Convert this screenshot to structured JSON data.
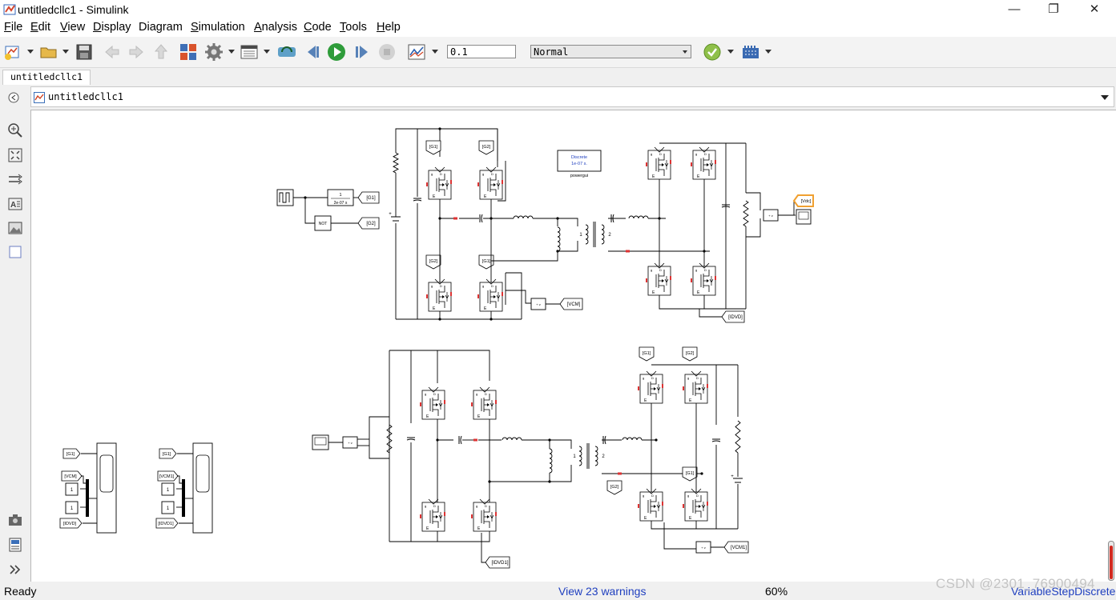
{
  "window": {
    "title": "untitledcllc1 - Simulink",
    "controls": {
      "minimize": "—",
      "restore": "❐",
      "close": "✕"
    }
  },
  "menu": [
    {
      "label": "File",
      "underline": "F",
      "rest": "ile"
    },
    {
      "label": "Edit",
      "underline": "E",
      "rest": "dit"
    },
    {
      "label": "View",
      "underline": "V",
      "rest": "iew"
    },
    {
      "label": "Display",
      "underline": "D",
      "rest": "isplay"
    },
    {
      "label": "Diagram",
      "underline": "",
      "rest": "Diagram"
    },
    {
      "label": "Simulation",
      "underline": "S",
      "rest": "imulation"
    },
    {
      "label": "Analysis",
      "underline": "A",
      "rest": "nalysis"
    },
    {
      "label": "Code",
      "underline": "C",
      "rest": "ode"
    },
    {
      "label": "Tools",
      "underline": "T",
      "rest": "ools"
    },
    {
      "label": "Help",
      "underline": "H",
      "rest": "elp"
    }
  ],
  "toolbar": {
    "stop_time": "0.1",
    "sim_mode": "Normal",
    "icons": [
      "new-model-icon",
      "open-icon",
      "save-icon",
      "back-icon",
      "forward-icon",
      "up-icon",
      "library-browser-icon",
      "model-config-icon",
      "model-explorer-icon",
      "update-diagram-icon",
      "step-back-icon",
      "run-icon",
      "step-forward-icon",
      "stop-icon",
      "data-inspector-icon",
      "model-advisor-icon",
      "build-icon"
    ]
  },
  "tab": {
    "label": "untitledcllc1"
  },
  "address": {
    "path": "untitledcllc1"
  },
  "palette_icons": [
    "zoom-icon",
    "fit-view-icon",
    "arrow-route-icon",
    "annotation-icon",
    "image-icon",
    "area-icon",
    "screenshot-icon",
    "model-browser-icon",
    "expand-icon"
  ],
  "diagram": {
    "powergui": {
      "line1": "Discrete",
      "line2": "1e-07 s.",
      "label": "powergui"
    },
    "delay": {
      "num": "1",
      "den": "2e-07 s"
    },
    "not_label": "NOT",
    "goto_g1": "[G1]",
    "goto_g2": "[G2]",
    "goto_vdc": "[Vdc]",
    "goto_vcm": "[VCM]",
    "goto_idvd": "[IDVD]",
    "goto_vcm1": "[VCM1]",
    "goto_idvd1": "[IDVD1]",
    "from_g1": "[G1]",
    "from_g2": "[G2]",
    "from_vcm": "[VCM]",
    "from_vcm1": "[VCM1]",
    "from_idvd": "[IDVD]",
    "from_idvd1": "[IDVD1]",
    "const_one": "1",
    "gate_e": "E",
    "gate_g": "g",
    "gate_d": "D",
    "xfmr_1": "1",
    "xfmr_2": "2"
  },
  "status": {
    "left": "Ready",
    "warnings": "View 23 warnings",
    "zoom": "60%",
    "solver": "VariableStepDiscrete"
  },
  "watermark": "CSDN @2301_76900494",
  "colors": {
    "accent_blue": "#1f3fbf",
    "wire": "#000000",
    "highlight": "#f0a030"
  }
}
